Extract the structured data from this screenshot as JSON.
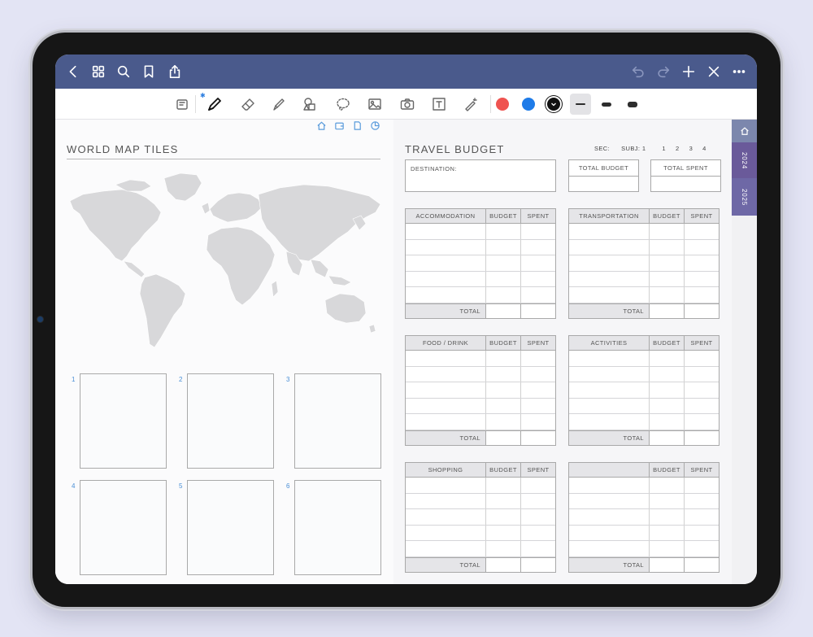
{
  "colors": {
    "background": "#e3e4f4",
    "topbar": "#4a5a8c",
    "accent_blue": "#4a8fd6",
    "swatch_red": "#ef5350",
    "swatch_blue": "#1e7be8",
    "swatch_black": "#111111",
    "tab_2024": "#6a5a9a",
    "tab_2025": "#6e68a6"
  },
  "topbar": {
    "left_icons": [
      "back-icon",
      "grid-icon",
      "search-icon",
      "bookmark-icon",
      "share-icon"
    ],
    "right_icons": [
      "undo-icon",
      "redo-icon",
      "add-icon",
      "close-icon",
      "more-icon"
    ]
  },
  "toolbar": {
    "tools": [
      "read-only-icon",
      "pen-icon",
      "eraser-icon",
      "highlighter-icon",
      "shapes-icon",
      "lasso-icon",
      "image-icon",
      "camera-icon",
      "text-icon",
      "laser-icon"
    ],
    "colors": [
      "red",
      "blue",
      "black"
    ],
    "stroke_widths": [
      "thin",
      "medium",
      "thick"
    ],
    "selected_stroke": "thin"
  },
  "left_page": {
    "title": "WORLD MAP TILES",
    "top_icons": [
      "home-mini-icon",
      "wallet-mini-icon",
      "document-mini-icon",
      "pie-chart-mini-icon"
    ],
    "tiles": [
      "1",
      "2",
      "3",
      "4",
      "5",
      "6"
    ]
  },
  "right_page": {
    "title": "TRAVEL BUDGET",
    "sec_label": "SEC:",
    "subj_label": "SUBJ: 1",
    "sec_numbers": [
      "1",
      "2",
      "3",
      "4"
    ],
    "destination_label": "DESTINATION:",
    "total_budget_label": "TOTAL BUDGET",
    "total_spent_label": "TOTAL SPENT",
    "budget_col": "BUDGET",
    "spent_col": "SPENT",
    "total_label": "TOTAL",
    "tables": [
      {
        "category": "ACCOMMODATION"
      },
      {
        "category": "TRANSPORTATION"
      },
      {
        "category": "FOOD / DRINK"
      },
      {
        "category": "ACTIVITIES"
      },
      {
        "category": "SHOPPING"
      },
      {
        "category": ""
      }
    ]
  },
  "side_tabs": {
    "home": "home-tab-icon",
    "years": [
      "2024",
      "2025"
    ]
  }
}
